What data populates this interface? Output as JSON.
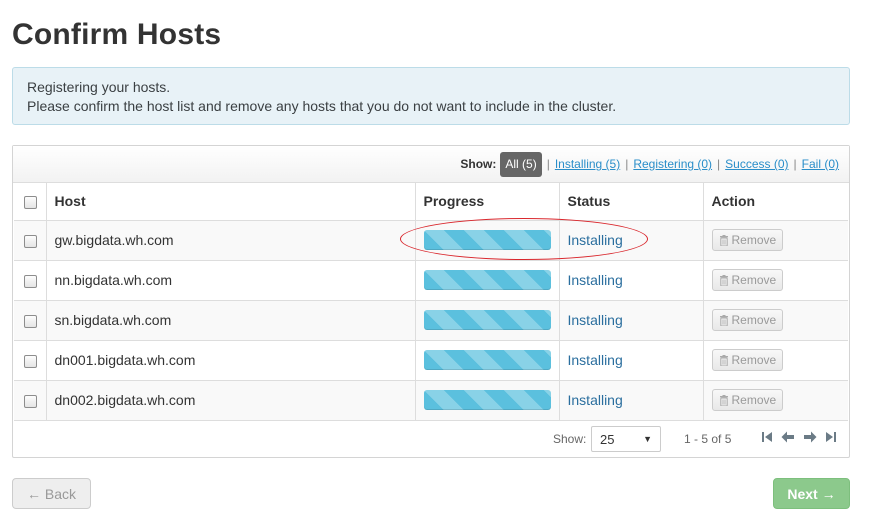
{
  "page": {
    "title": "Confirm Hosts"
  },
  "alert": {
    "line1": "Registering your hosts.",
    "line2": "Please confirm the host list and remove any hosts that you do not want to include in the cluster."
  },
  "filters": {
    "show_label": "Show:",
    "all": "All (5)",
    "installing": "Installing (5)",
    "registering": "Registering (0)",
    "success": "Success (0)",
    "fail": "Fail (0)",
    "separator": "|"
  },
  "table": {
    "columns": [
      "Host",
      "Progress",
      "Status",
      "Action"
    ],
    "rows": [
      {
        "host": "gw.bigdata.wh.com",
        "status": "Installing",
        "action": "Remove"
      },
      {
        "host": "nn.bigdata.wh.com",
        "status": "Installing",
        "action": "Remove"
      },
      {
        "host": "sn.bigdata.wh.com",
        "status": "Installing",
        "action": "Remove"
      },
      {
        "host": "dn001.bigdata.wh.com",
        "status": "Installing",
        "action": "Remove"
      },
      {
        "host": "dn002.bigdata.wh.com",
        "status": "Installing",
        "action": "Remove"
      }
    ]
  },
  "pagination": {
    "show_label": "Show:",
    "page_size": "25",
    "range": "1 - 5 of 5"
  },
  "buttons": {
    "back": "← Back",
    "next": "Next →"
  },
  "colors": {
    "progress": "#5bc0de",
    "status_link": "#2a6e9e",
    "next_button": "#8cc98c",
    "annotation": "#d9262c"
  },
  "icons": [
    "trash-icon",
    "first-page-icon",
    "prev-page-icon",
    "next-page-icon",
    "last-page-icon",
    "caret-down-icon"
  ]
}
